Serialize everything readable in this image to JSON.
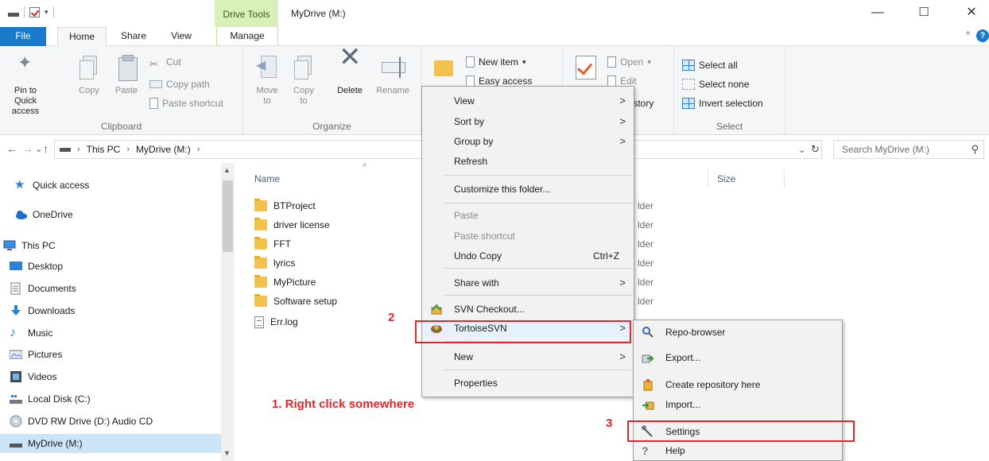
{
  "window": {
    "title": "MyDrive (M:)",
    "contextual_tab": "Drive Tools",
    "minimize": "—",
    "maximize": "☐",
    "close": "✕"
  },
  "tabs": {
    "file": "File",
    "home": "Home",
    "share": "Share",
    "view": "View",
    "manage": "Manage",
    "collapse": "^",
    "help": "?"
  },
  "ribbon": {
    "clipboard": {
      "label": "Clipboard",
      "pin": "Pin to Quick access",
      "copy": "Copy",
      "paste": "Paste",
      "cut": "Cut",
      "copy_path": "Copy path",
      "paste_shortcut": "Paste shortcut"
    },
    "organize": {
      "label": "Organize",
      "move_to": "Move to",
      "copy_to": "Copy to",
      "delete": "Delete",
      "rename": "Rename"
    },
    "new": {
      "new_item": "New item",
      "easy_access": "Easy access"
    },
    "open": {
      "open": "Open",
      "edit": "Edit",
      "history": "History"
    },
    "select": {
      "label": "Select",
      "select_all": "Select all",
      "select_none": "Select none",
      "invert": "Invert selection"
    }
  },
  "address": {
    "back": "←",
    "forward": "→",
    "recent": "⌄",
    "up": "↑",
    "crumbs": [
      "This PC",
      "MyDrive (M:)"
    ],
    "dropdown": "⌄",
    "refresh": "↻",
    "search_placeholder": "Search MyDrive (M:)",
    "search_icon": "⚲"
  },
  "nav": {
    "items": [
      {
        "label": "Quick access",
        "icon": "star-icon"
      },
      {
        "label": "OneDrive",
        "icon": "cloud-icon"
      },
      {
        "label": "This PC",
        "icon": "pc-icon"
      },
      {
        "label": "Desktop",
        "icon": "desktop-icon"
      },
      {
        "label": "Documents",
        "icon": "documents-icon"
      },
      {
        "label": "Downloads",
        "icon": "downloads-icon"
      },
      {
        "label": "Music",
        "icon": "music-icon"
      },
      {
        "label": "Pictures",
        "icon": "pictures-icon"
      },
      {
        "label": "Videos",
        "icon": "videos-icon"
      },
      {
        "label": "Local Disk (C:)",
        "icon": "local-disk-icon"
      },
      {
        "label": "DVD RW Drive (D:) Audio CD",
        "icon": "dvd-icon"
      },
      {
        "label": "MyDrive (M:)",
        "icon": "drive-icon",
        "selected": true
      }
    ]
  },
  "columns": {
    "name": "Name",
    "size": "Size",
    "sort_indicator": "^"
  },
  "files": [
    {
      "name": "BTProject",
      "type": "folder"
    },
    {
      "name": "driver license",
      "type": "folder"
    },
    {
      "name": "FFT",
      "type": "folder"
    },
    {
      "name": "lyrics",
      "type": "folder"
    },
    {
      "name": "MyPicture",
      "type": "folder"
    },
    {
      "name": "Software setup",
      "type": "folder"
    },
    {
      "name": "Err.log",
      "type": "file"
    }
  ],
  "type_fragment": "lder",
  "context_menu": {
    "view": "View",
    "sort_by": "Sort by",
    "group_by": "Group by",
    "refresh": "Refresh",
    "customize": "Customize this folder...",
    "paste": "Paste",
    "paste_shortcut": "Paste shortcut",
    "undo_copy": "Undo Copy",
    "undo_shortcut": "Ctrl+Z",
    "share_with": "Share with",
    "svn_checkout": "SVN Checkout...",
    "tortoisesvn": "TortoiseSVN",
    "new": "New",
    "properties": "Properties",
    "arrow": ">"
  },
  "submenu": {
    "repo_browser": "Repo-browser",
    "export": "Export...",
    "create_repo": "Create repository here",
    "import": "Import...",
    "settings": "Settings",
    "help": "Help"
  },
  "annotations": {
    "step1": "1. Right click somewhere",
    "step2": "2",
    "step3": "3",
    "color": "#e3262b"
  }
}
